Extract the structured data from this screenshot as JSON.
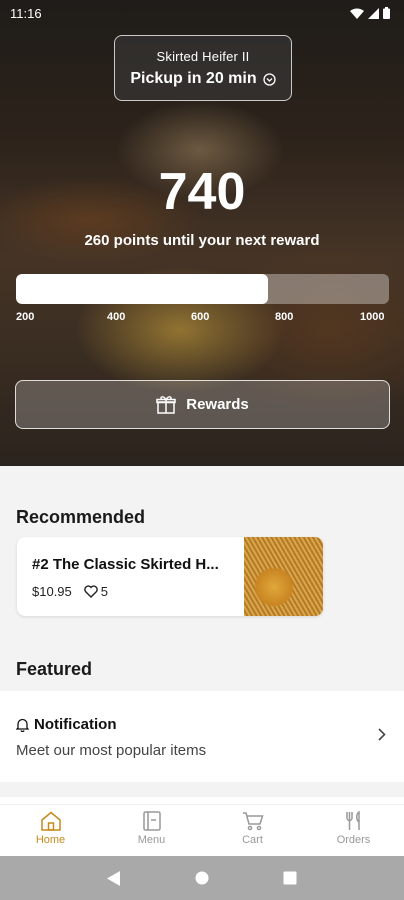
{
  "status_bar": {
    "time": "11:16"
  },
  "hero": {
    "store_name": "Skirted Heifer II",
    "pickup_text": "Pickup in 20 min",
    "points": "740",
    "points_subtitle": "260 points until your next reward",
    "progress": {
      "min": 200,
      "max": 1000,
      "current": 740,
      "ticks": [
        "200",
        "400",
        "600",
        "800",
        "1000"
      ]
    },
    "rewards_label": "Rewards"
  },
  "recommended": {
    "title": "Recommended",
    "item": {
      "name": "#2 The Classic Skirted H...",
      "price": "$10.95",
      "likes": "5"
    }
  },
  "featured": {
    "title": "Featured",
    "notification_title": "Notification",
    "notification_subtitle": "Meet our most popular items"
  },
  "nav": {
    "items": [
      {
        "label": "Home",
        "icon": "home-icon",
        "active": true
      },
      {
        "label": "Menu",
        "icon": "menu-icon",
        "active": false
      },
      {
        "label": "Cart",
        "icon": "cart-icon",
        "active": false
      },
      {
        "label": "Orders",
        "icon": "orders-icon",
        "active": false
      }
    ]
  },
  "colors": {
    "accent": "#c58a1d",
    "inactive": "#999999",
    "system_nav": "#a9a9a9"
  }
}
